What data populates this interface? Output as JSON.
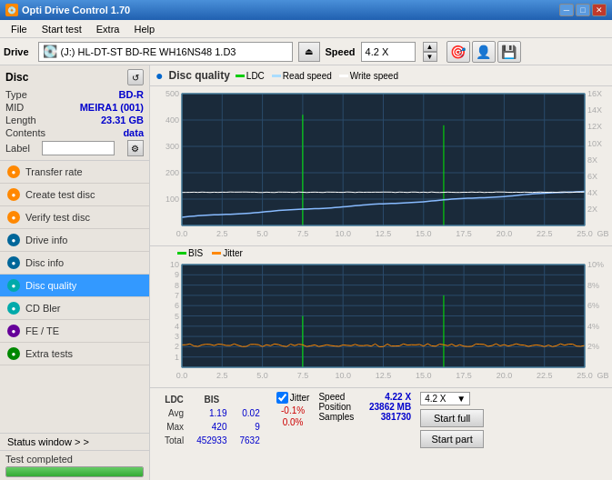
{
  "titlebar": {
    "title": "Opti Drive Control 1.70",
    "icon": "💿",
    "controls": [
      "─",
      "□",
      "✕"
    ]
  },
  "menubar": {
    "items": [
      "File",
      "Start test",
      "Extra",
      "Help"
    ]
  },
  "drivebar": {
    "drive_label": "Drive",
    "drive_value": "(J:)  HL-DT-ST BD-RE  WH16NS48 1.D3",
    "speed_label": "Speed",
    "speed_value": "4.2 X"
  },
  "disc": {
    "title": "Disc",
    "type_label": "Type",
    "type_value": "BD-R",
    "mid_label": "MID",
    "mid_value": "MEIRA1 (001)",
    "length_label": "Length",
    "length_value": "23.31 GB",
    "contents_label": "Contents",
    "contents_value": "data",
    "label_label": "Label",
    "label_value": ""
  },
  "sidebar_menu": [
    {
      "id": "transfer-rate",
      "label": "Transfer rate",
      "icon_class": "icon-orange"
    },
    {
      "id": "create-test-disc",
      "label": "Create test disc",
      "icon_class": "icon-orange"
    },
    {
      "id": "verify-test-disc",
      "label": "Verify test disc",
      "icon_class": "icon-orange"
    },
    {
      "id": "drive-info",
      "label": "Drive info",
      "icon_class": "icon-blue"
    },
    {
      "id": "disc-info",
      "label": "Disc info",
      "icon_class": "icon-blue"
    },
    {
      "id": "disc-quality",
      "label": "Disc quality",
      "icon_class": "icon-teal",
      "active": true
    },
    {
      "id": "cd-bler",
      "label": "CD Bler",
      "icon_class": "icon-teal"
    },
    {
      "id": "fe-te",
      "label": "FE / TE",
      "icon_class": "icon-purple"
    },
    {
      "id": "extra-tests",
      "label": "Extra tests",
      "icon_class": "icon-green"
    }
  ],
  "status_window": {
    "label": "Status window > >"
  },
  "test_completed": {
    "label": "Test completed",
    "progress": 100
  },
  "chart": {
    "title": "Disc quality",
    "icon": "●",
    "legend": {
      "ldc": "LDC",
      "read": "Read speed",
      "write": "Write speed"
    },
    "legend_bottom": {
      "bis": "BIS",
      "jitter": "Jitter"
    },
    "top": {
      "y_max": 500,
      "y_labels": [
        500,
        400,
        300,
        200,
        100
      ],
      "x_labels": [
        "0.0",
        "2.5",
        "5.0",
        "7.5",
        "10.0",
        "12.5",
        "15.0",
        "17.5",
        "20.0",
        "22.5",
        "25.0"
      ],
      "y_right_labels": [
        "16X",
        "14X",
        "12X",
        "10X",
        "8X",
        "6X",
        "4X",
        "2X"
      ],
      "unit": "GB"
    },
    "bottom": {
      "y_max": 10,
      "y_labels": [
        10,
        9,
        8,
        7,
        6,
        5,
        4,
        3,
        2,
        1
      ],
      "x_labels": [
        "0.0",
        "2.5",
        "5.0",
        "7.5",
        "10.0",
        "12.5",
        "15.0",
        "17.5",
        "20.0",
        "22.5",
        "25.0"
      ],
      "y_right_labels": [
        "10%",
        "8%",
        "6%",
        "4%",
        "2%"
      ]
    }
  },
  "stats": {
    "avg_ldc": "1.19",
    "avg_bis": "0.02",
    "avg_jitter": "-0.1%",
    "max_ldc": "420",
    "max_bis": "9",
    "max_jitter": "0.0%",
    "total_ldc": "452933",
    "total_bis": "7632",
    "speed_label": "Speed",
    "speed_value": "4.22 X",
    "position_label": "Position",
    "position_value": "23862 MB",
    "samples_label": "Samples",
    "samples_value": "381730",
    "jitter_checked": true,
    "speed_select": "4.2 X"
  },
  "buttons": {
    "start_full": "Start full",
    "start_part": "Start part"
  }
}
